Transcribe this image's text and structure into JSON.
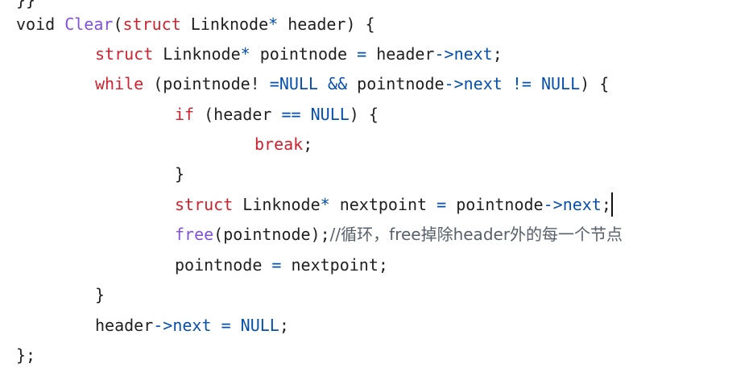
{
  "editor": {
    "colors": {
      "background": "#ffffff",
      "plain": "#1f1f1f",
      "keyword": "#cf222e",
      "function": "#8250df",
      "operator": "#0550ae",
      "constant": "#0550ae",
      "comment": "#57606a"
    },
    "lines": [
      {
        "tokens": [
          {
            "t": "}}",
            "c": "plain"
          }
        ]
      },
      {
        "tokens": [
          {
            "t": "void ",
            "c": "plain"
          },
          {
            "t": "Clear",
            "c": "func"
          },
          {
            "t": "(",
            "c": "plain"
          },
          {
            "t": "struct",
            "c": "keyword"
          },
          {
            "t": " Linknode",
            "c": "plain"
          },
          {
            "t": "*",
            "c": "op"
          },
          {
            "t": " header) {",
            "c": "plain"
          }
        ]
      },
      {
        "tokens": [
          {
            "t": "struct",
            "c": "keyword"
          },
          {
            "t": " Linknode",
            "c": "plain"
          },
          {
            "t": "*",
            "c": "op"
          },
          {
            "t": " pointnode ",
            "c": "plain"
          },
          {
            "t": "=",
            "c": "op"
          },
          {
            "t": " header",
            "c": "plain"
          },
          {
            "t": "->",
            "c": "op"
          },
          {
            "t": "next",
            "c": "op"
          },
          {
            "t": ";",
            "c": "plain"
          }
        ]
      },
      {
        "tokens": [
          {
            "t": "while",
            "c": "keyword"
          },
          {
            "t": " (pointnode! ",
            "c": "plain"
          },
          {
            "t": "=",
            "c": "op"
          },
          {
            "t": "NULL",
            "c": "const"
          },
          {
            "t": " && ",
            "c": "op"
          },
          {
            "t": "pointnode",
            "c": "plain"
          },
          {
            "t": "->",
            "c": "op"
          },
          {
            "t": "next",
            "c": "op"
          },
          {
            "t": " != ",
            "c": "op"
          },
          {
            "t": "NULL",
            "c": "const"
          },
          {
            "t": ") {",
            "c": "plain"
          }
        ]
      },
      {
        "tokens": [
          {
            "t": "if",
            "c": "keyword"
          },
          {
            "t": " (header ",
            "c": "plain"
          },
          {
            "t": "==",
            "c": "op"
          },
          {
            "t": " ",
            "c": "plain"
          },
          {
            "t": "NULL",
            "c": "const"
          },
          {
            "t": ") {",
            "c": "plain"
          }
        ]
      },
      {
        "tokens": [
          {
            "t": "break",
            "c": "keyword"
          },
          {
            "t": ";",
            "c": "plain"
          }
        ]
      },
      {
        "tokens": [
          {
            "t": "}",
            "c": "plain"
          }
        ]
      },
      {
        "tokens": [
          {
            "t": "struct",
            "c": "keyword"
          },
          {
            "t": " Linknode",
            "c": "plain"
          },
          {
            "t": "*",
            "c": "op"
          },
          {
            "t": " nextpoint ",
            "c": "plain"
          },
          {
            "t": "=",
            "c": "op"
          },
          {
            "t": " pointnode",
            "c": "plain"
          },
          {
            "t": "->",
            "c": "op"
          },
          {
            "t": "next",
            "c": "op"
          },
          {
            "t": ";",
            "c": "plain"
          }
        ],
        "caret": true
      },
      {
        "tokens": [
          {
            "t": "free",
            "c": "func"
          },
          {
            "t": "(pointnode);",
            "c": "plain"
          },
          {
            "t": "//循环，free掉除header外的每一个节点",
            "c": "comment"
          }
        ]
      },
      {
        "tokens": [
          {
            "t": "pointnode ",
            "c": "plain"
          },
          {
            "t": "=",
            "c": "op"
          },
          {
            "t": " nextpoint;",
            "c": "plain"
          }
        ]
      },
      {
        "tokens": [
          {
            "t": "}",
            "c": "plain"
          }
        ]
      },
      {
        "tokens": [
          {
            "t": "header",
            "c": "plain"
          },
          {
            "t": "->",
            "c": "op"
          },
          {
            "t": "next",
            "c": "op"
          },
          {
            "t": " ",
            "c": "plain"
          },
          {
            "t": "=",
            "c": "op"
          },
          {
            "t": " ",
            "c": "plain"
          },
          {
            "t": "NULL",
            "c": "const"
          },
          {
            "t": ";",
            "c": "plain"
          }
        ]
      },
      {
        "tokens": [
          {
            "t": "};",
            "c": "plain"
          }
        ]
      }
    ]
  }
}
